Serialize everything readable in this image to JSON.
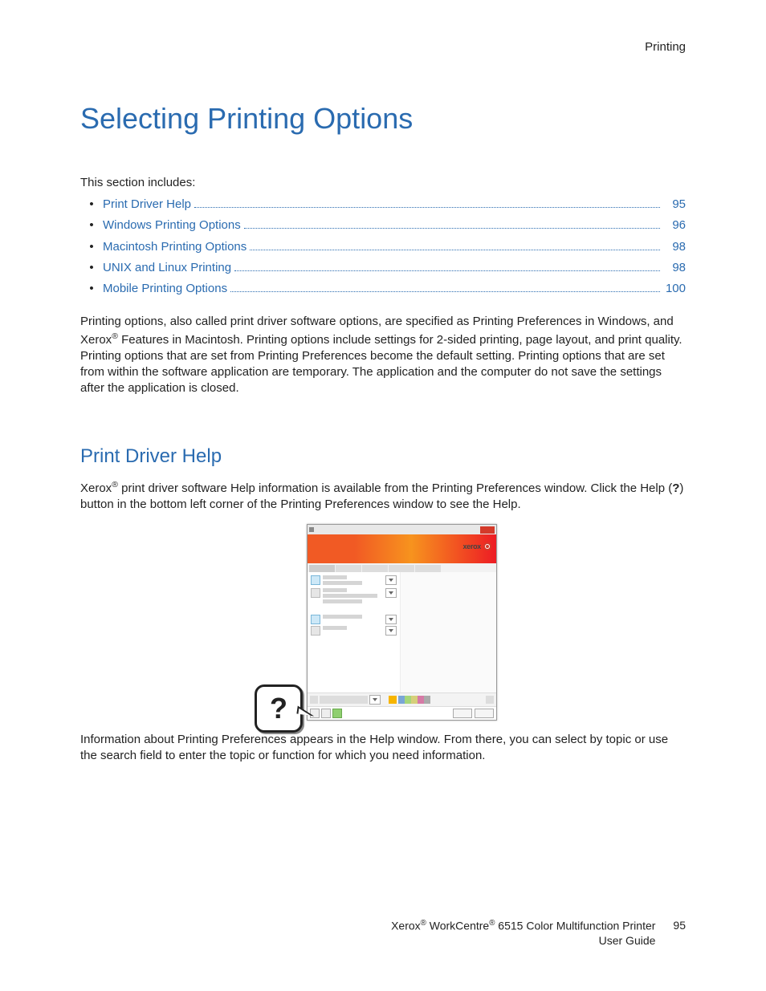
{
  "header": {
    "section": "Printing"
  },
  "title": "Selecting Printing Options",
  "intro": "This section includes:",
  "toc": [
    {
      "label": "Print Driver Help",
      "page": "95"
    },
    {
      "label": "Windows Printing Options",
      "page": "96"
    },
    {
      "label": "Macintosh Printing Options",
      "page": "98"
    },
    {
      "label": "UNIX and Linux Printing",
      "page": "98"
    },
    {
      "label": "Mobile Printing Options",
      "page": "100"
    }
  ],
  "para1a": "Printing options, also called print driver software options, are specified as Printing Preferences in Windows, and Xerox",
  "para1b": " Features in Macintosh. Printing options include settings for 2-sided printing, page layout, and print quality. Printing options that are set from Printing Preferences become the default setting. Printing options that are set from within the software application are temporary. The application and the computer do not save the settings after the application is closed.",
  "subhead": "Print Driver Help",
  "para2a": "Xerox",
  "para2b": " print driver software Help information is available from the Printing Preferences window. Click the Help (",
  "para2c": "?",
  "para2d": ") button in the bottom left corner of the Printing Preferences window to see the Help.",
  "dialog": {
    "logo": "xerox"
  },
  "help_symbol": "?",
  "para3": "Information about Printing Preferences appears in the Help window. From there, you can select by topic or use the search field to enter the topic or function for which you need information.",
  "footer": {
    "line1a": "Xerox",
    "line1b": " WorkCentre",
    "line1c": " 6515 Color Multifunction Printer",
    "line2": "User Guide",
    "page": "95"
  },
  "reg": "®"
}
